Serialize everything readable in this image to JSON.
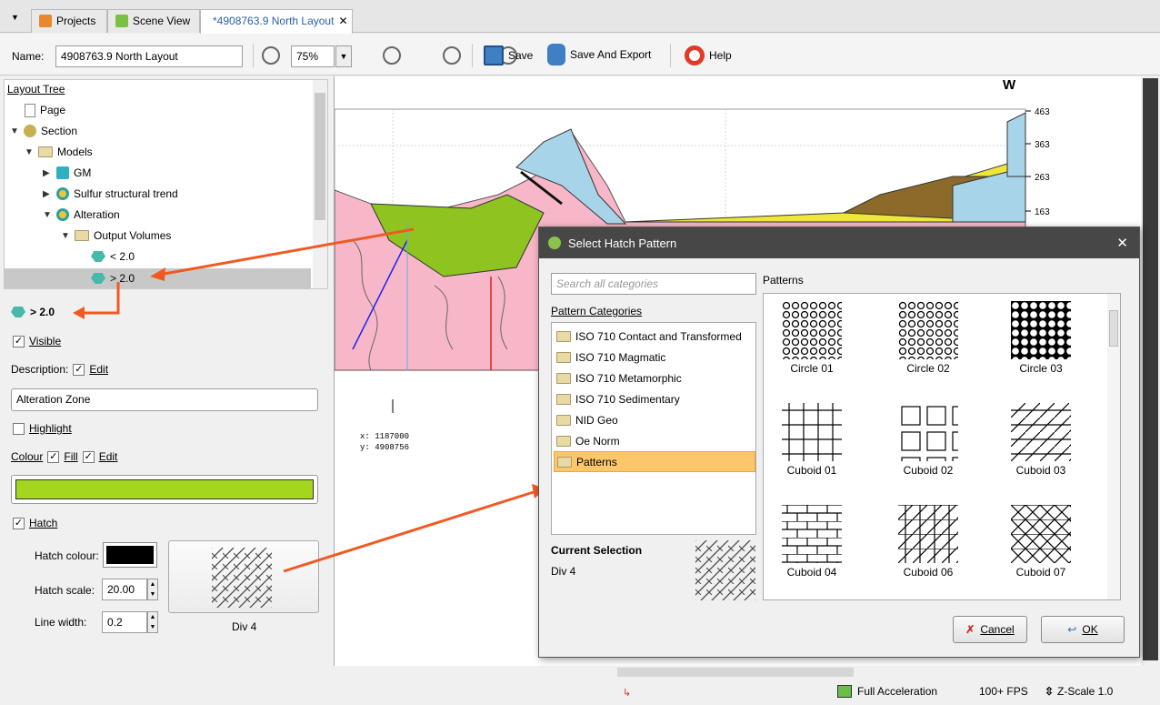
{
  "tabs": [
    {
      "label": "Projects"
    },
    {
      "label": "Scene View"
    },
    {
      "label": "*4908763.9 North Layout"
    }
  ],
  "toolbar": {
    "name_label": "Name:",
    "name_value": "4908763.9 North Layout",
    "zoom": "75%",
    "save": "Save",
    "save_export": "Save And Export",
    "help": "Help"
  },
  "tree": {
    "header": "Layout Tree",
    "items": [
      "Page",
      "Section",
      "Models",
      "GM",
      "Sulfur structural trend",
      "Alteration",
      "Output Volumes",
      "< 2.0",
      "> 2.0"
    ]
  },
  "props": {
    "title": "> 2.0",
    "visible": "Visible",
    "description_label": "Description:",
    "edit": "Edit",
    "description_value": "Alteration Zone",
    "highlight": "Highlight",
    "colour": "Colour",
    "fill": "Fill",
    "fill_color": "#a5d61e",
    "hatch": "Hatch",
    "hatch_colour": "Hatch colour:",
    "hatch_color_value": "#000000",
    "hatch_scale": "Hatch scale:",
    "hatch_scale_value": "20.00",
    "line_width": "Line width:",
    "line_width_value": "0.2",
    "pattern_name": "Div 4"
  },
  "canvas": {
    "axis_right": [
      "463",
      "363",
      "263",
      "163"
    ],
    "compass": "W",
    "coord_x": "x: 1187000",
    "coord_y": "y: 4908756"
  },
  "dialog": {
    "title": "Select Hatch Pattern",
    "search_placeholder": "Search all categories",
    "categories_label": "Pattern Categories",
    "categories": [
      "ISO 710 Contact and Transformed",
      "ISO 710 Magmatic",
      "ISO 710 Metamorphic",
      "ISO 710 Sedimentary",
      "NID Geo",
      "Oe Norm",
      "Patterns"
    ],
    "patterns_label": "Patterns",
    "patterns": [
      "Circle 01",
      "Circle 02",
      "Circle 03",
      "Cuboid 01",
      "Cuboid 02",
      "Cuboid 03",
      "Cuboid 04",
      "Cuboid 06",
      "Cuboid 07"
    ],
    "current_selection_label": "Current Selection",
    "current_selection_value": "Div 4",
    "cancel": "Cancel",
    "ok": "OK"
  },
  "status": {
    "acceleration": "Full Acceleration",
    "fps": "100+ FPS",
    "zscale": "Z-Scale 1.0"
  }
}
